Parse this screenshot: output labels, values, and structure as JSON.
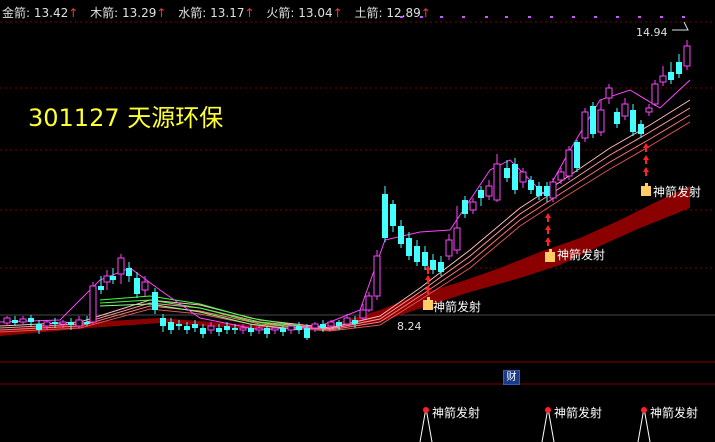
{
  "header": {
    "indicators": [
      {
        "name": "金箭",
        "value": "13.42"
      },
      {
        "name": "木箭",
        "value": "13.29"
      },
      {
        "name": "水箭",
        "value": "13.17"
      },
      {
        "name": "火箭",
        "value": "13.04"
      },
      {
        "name": "土箭",
        "value": "12.89"
      }
    ],
    "arrow_glyph": "↑"
  },
  "stock": {
    "code": "301127",
    "name": "天源环保"
  },
  "price_labels": {
    "high": "14.94",
    "low": "8.24"
  },
  "signal_label": "神箭发射",
  "badge_label": "财",
  "colors": {
    "up_candle": "#ff44ff",
    "down_candle": "#44ffff",
    "band": "#8b0000",
    "grid": "#7a0000",
    "ma_short": "#ff44ff",
    "ma_mid": "#44ff44",
    "text_hdr": "#e0e0e0",
    "title": "#ffff33",
    "signal_text": "#ffffff"
  },
  "icons": {
    "signal_hand": "hand-pointer-icon",
    "signal_arrow": "red-up-arrow-icon"
  }
}
